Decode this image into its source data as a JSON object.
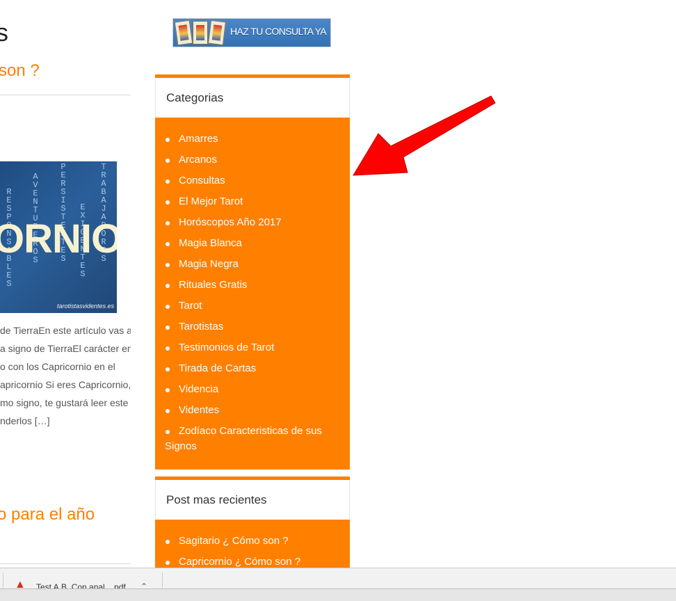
{
  "left_column": {
    "title_fragment": "s",
    "post1_title_fragment": "son ?",
    "thumbnail": {
      "big_text": "ORNIO",
      "vertical_words": [
        "RESPONSABLES",
        "AVENTUREROS",
        "PERSISTENTES",
        "EXIGENTES",
        "TRABAJADORES"
      ],
      "watermark": "tarotistasvidentes.es"
    },
    "excerpt_lines": [
      "de TierraEn este artículo vas a",
      "a signo de TierraEl carácter en",
      "o con los Capricornio en el",
      "apricornio Si eres Capricornio,",
      "mo signo, te gustará leer este",
      "nderlos […]"
    ],
    "post2_title_fragment": "o para el año"
  },
  "banner": {
    "text": "HAZ TU CONSULTA YA"
  },
  "categories_widget": {
    "title": "Categorias",
    "items": [
      "Amarres",
      "Arcanos",
      "Consultas",
      "El Mejor Tarot",
      "Horóscopos Año 2017",
      "Magia Blanca",
      "Magia Negra",
      "Rituales Gratis",
      "Tarot",
      "Tarotistas",
      "Testimonios de Tarot",
      "Tirada de Cartas",
      "Videncia",
      "Videntes",
      "Zodíaco Caracteristicas de sus Signos"
    ]
  },
  "recent_posts_widget": {
    "title": "Post mas recientes",
    "items": [
      "Sagitario ¿ Cómo son ?",
      "Capricornio ¿ Cómo son ?"
    ]
  },
  "download_bar": {
    "file_name": "Test A.B. Con anal... pdf",
    "file_icon": "pdf-icon",
    "chevron_icon": "chevron-up-icon"
  },
  "colors": {
    "accent": "#ff7f00",
    "arrow": "#ff0000",
    "banner": "#3f7fc0"
  }
}
